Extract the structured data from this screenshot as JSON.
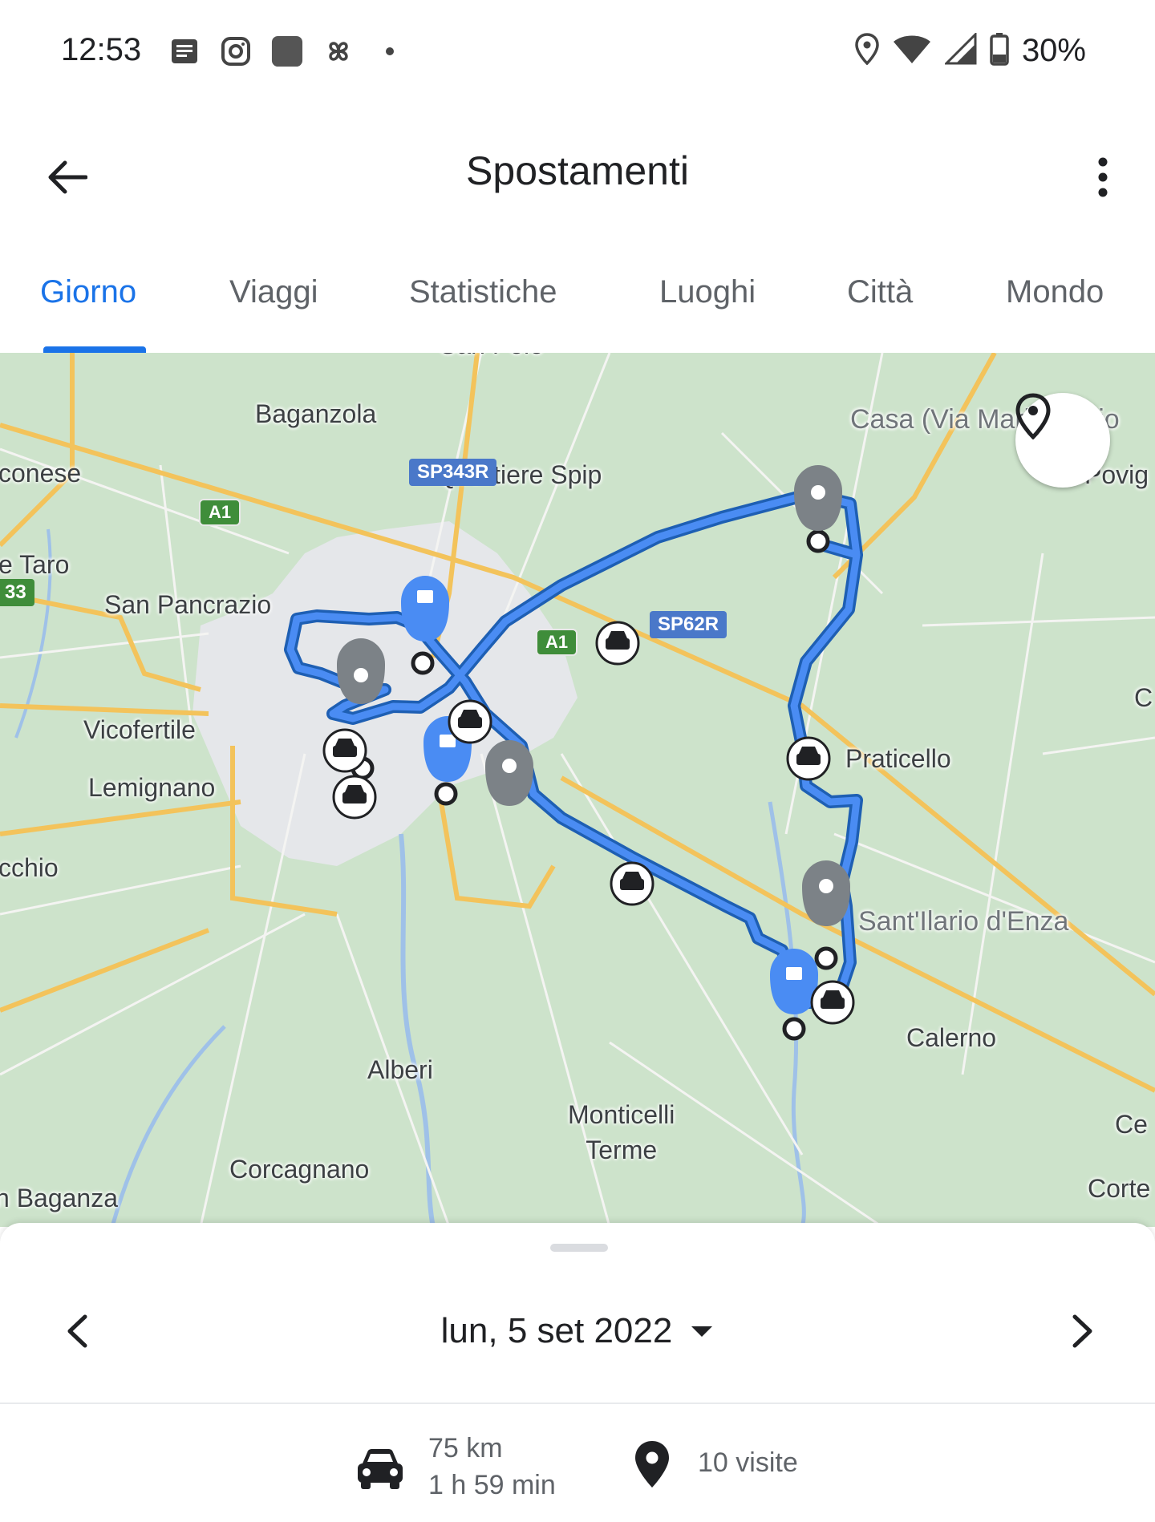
{
  "status_bar": {
    "time": "12:53",
    "battery_percent": "30%",
    "icons": [
      "notes-icon",
      "instagram-icon",
      "app-square-icon",
      "pinwheel-icon",
      "dot-icon",
      "location-icon",
      "wifi-icon",
      "signal-icon",
      "battery-icon"
    ]
  },
  "app_bar": {
    "title": "Spostamenti",
    "back_icon": "arrow-left-icon",
    "menu_icon": "more-vert-icon"
  },
  "tabs": [
    {
      "label": "Giorno",
      "active": true
    },
    {
      "label": "Viaggi",
      "active": false
    },
    {
      "label": "Statistiche",
      "active": false
    },
    {
      "label": "Luoghi",
      "active": false
    },
    {
      "label": "Città",
      "active": false
    },
    {
      "label": "Mondo",
      "active": false
    }
  ],
  "map": {
    "labels": {
      "baganzola": "Baganzola",
      "quartiere_spip": "Quartiere Spip",
      "casa": "Casa (Via Mario Clivio",
      "povig": "Povig",
      "conese": "conese",
      "taro": "e Taro",
      "san_pancrazio": "San Pancrazio",
      "praticello": "Praticello",
      "vicofertile": "Vicofertile",
      "lemignano": "Lemignano",
      "santilario": "Sant'Ilario d'Enza",
      "cchio": "cchio",
      "calerno": "Calerno",
      "alberi": "Alberi",
      "monticelli": "Monticelli\nTerme",
      "corcagnano": "Corcagnano",
      "baganza": "n Baganza",
      "ce": "Ce",
      "corte": "Corte",
      "c": "C",
      "san_polo": "San Polo",
      "num_33": "33"
    },
    "road_badges": {
      "sp343r": "SP343R",
      "sp62r": "SP62R",
      "a1_left": "A1",
      "a1_right": "A1"
    },
    "route_color": "#4285f4",
    "my_location_icon": "location-pin-icon"
  },
  "sheet": {
    "date": "lun, 5 set 2022",
    "prev_icon": "chevron-left-icon",
    "next_icon": "chevron-right-icon",
    "dropdown_icon": "caret-down-icon",
    "distance": "75 km",
    "duration": "1 h 59 min",
    "visits": "10 visite"
  }
}
